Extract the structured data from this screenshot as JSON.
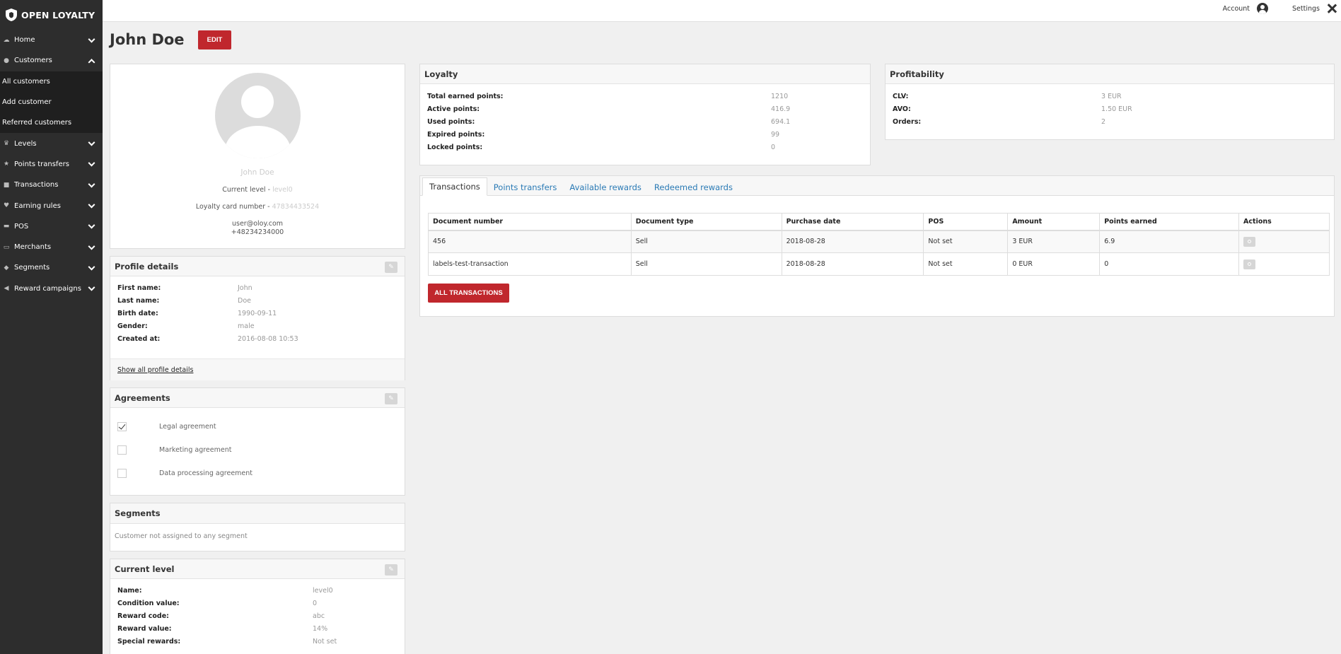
{
  "brand": {
    "name": "OPEN LOYALTY"
  },
  "sidebar": {
    "items": [
      {
        "label": "Home",
        "icon": "cloud-icon",
        "expanded": false
      },
      {
        "label": "Customers",
        "icon": "users-icon",
        "expanded": true
      },
      {
        "label": "Levels",
        "icon": "trophy-icon",
        "expanded": false
      },
      {
        "label": "Points transfers",
        "icon": "star-icon",
        "expanded": false
      },
      {
        "label": "Transactions",
        "icon": "briefcase-icon",
        "expanded": false
      },
      {
        "label": "Earning rules",
        "icon": "heart-icon",
        "expanded": false
      },
      {
        "label": "POS",
        "icon": "pos-icon",
        "expanded": false
      },
      {
        "label": "Merchants",
        "icon": "merchant-icon",
        "expanded": false
      },
      {
        "label": "Segments",
        "icon": "tag-icon",
        "expanded": false
      },
      {
        "label": "Reward campaigns",
        "icon": "megaphone-icon",
        "expanded": false
      }
    ],
    "customers_sub": [
      "All customers",
      "Add customer",
      "Referred customers"
    ]
  },
  "topbar": {
    "account": "Account",
    "settings": "Settings"
  },
  "header": {
    "title": "John Doe",
    "edit": "EDIT"
  },
  "profile": {
    "name": "John Doe",
    "level_label": "Current level -",
    "level_value": "level0",
    "card_label": "Loyalty card number -",
    "card_value": "47834433524",
    "email": "user@oloy.com",
    "phone": "+48234234000"
  },
  "profile_details": {
    "title": "Profile details",
    "rows": [
      {
        "k": "First name:",
        "v": "John"
      },
      {
        "k": "Last name:",
        "v": "Doe"
      },
      {
        "k": "Birth date:",
        "v": "1990-09-11"
      },
      {
        "k": "Gender:",
        "v": "male"
      },
      {
        "k": "Created at:",
        "v": "2016-08-08 10:53"
      }
    ],
    "show_all": "Show all profile details"
  },
  "agreements": {
    "title": "Agreements",
    "items": [
      {
        "label": "Legal agreement",
        "checked": true
      },
      {
        "label": "Marketing agreement",
        "checked": false
      },
      {
        "label": "Data processing agreement",
        "checked": false
      }
    ]
  },
  "segments": {
    "title": "Segments",
    "text": "Customer not assigned to any segment"
  },
  "current_level": {
    "title": "Current level",
    "rows": [
      {
        "k": "Name:",
        "v": "level0"
      },
      {
        "k": "Condition value:",
        "v": "0"
      },
      {
        "k": "Reward code:",
        "v": "abc"
      },
      {
        "k": "Reward value:",
        "v": "14%"
      },
      {
        "k": "Special rewards:",
        "v": "Not set"
      }
    ]
  },
  "loyalty": {
    "title": "Loyalty",
    "rows": [
      {
        "k": "Total earned points:",
        "v": "1210"
      },
      {
        "k": "Active points:",
        "v": "416.9"
      },
      {
        "k": "Used points:",
        "v": "694.1"
      },
      {
        "k": "Expired points:",
        "v": "99"
      },
      {
        "k": "Locked points:",
        "v": "0"
      }
    ]
  },
  "profitability": {
    "title": "Profitability",
    "rows": [
      {
        "k": "CLV:",
        "v": "3 EUR"
      },
      {
        "k": "AVO:",
        "v": "1.50 EUR"
      },
      {
        "k": "Orders:",
        "v": "2"
      }
    ]
  },
  "tabs": [
    "Transactions",
    "Points transfers",
    "Available rewards",
    "Redeemed rewards"
  ],
  "transactions": {
    "columns": [
      "Document number",
      "Document type",
      "Purchase date",
      "POS",
      "Amount",
      "Points earned",
      "Actions"
    ],
    "rows": [
      [
        "456",
        "Sell",
        "2018-08-28",
        "Not set",
        "3 EUR",
        "6.9"
      ],
      [
        "labels-test-transaction",
        "Sell",
        "2018-08-28",
        "Not set",
        "0 EUR",
        "0"
      ]
    ],
    "all_button": "ALL TRANSACTIONS"
  },
  "colors": {
    "accent": "#c0272d",
    "sidebar": "#2d2d2d",
    "link": "#2a7ab5"
  }
}
